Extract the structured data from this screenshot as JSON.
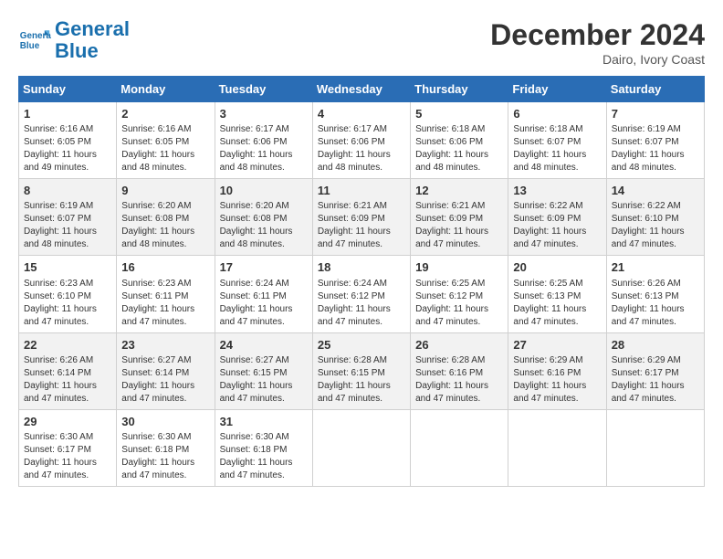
{
  "header": {
    "logo_line1": "General",
    "logo_line2": "Blue",
    "month": "December 2024",
    "location": "Dairo, Ivory Coast"
  },
  "days_of_week": [
    "Sunday",
    "Monday",
    "Tuesday",
    "Wednesday",
    "Thursday",
    "Friday",
    "Saturday"
  ],
  "weeks": [
    [
      {
        "day": "1",
        "info": "Sunrise: 6:16 AM\nSunset: 6:05 PM\nDaylight: 11 hours\nand 49 minutes."
      },
      {
        "day": "2",
        "info": "Sunrise: 6:16 AM\nSunset: 6:05 PM\nDaylight: 11 hours\nand 48 minutes."
      },
      {
        "day": "3",
        "info": "Sunrise: 6:17 AM\nSunset: 6:06 PM\nDaylight: 11 hours\nand 48 minutes."
      },
      {
        "day": "4",
        "info": "Sunrise: 6:17 AM\nSunset: 6:06 PM\nDaylight: 11 hours\nand 48 minutes."
      },
      {
        "day": "5",
        "info": "Sunrise: 6:18 AM\nSunset: 6:06 PM\nDaylight: 11 hours\nand 48 minutes."
      },
      {
        "day": "6",
        "info": "Sunrise: 6:18 AM\nSunset: 6:07 PM\nDaylight: 11 hours\nand 48 minutes."
      },
      {
        "day": "7",
        "info": "Sunrise: 6:19 AM\nSunset: 6:07 PM\nDaylight: 11 hours\nand 48 minutes."
      }
    ],
    [
      {
        "day": "8",
        "info": "Sunrise: 6:19 AM\nSunset: 6:07 PM\nDaylight: 11 hours\nand 48 minutes."
      },
      {
        "day": "9",
        "info": "Sunrise: 6:20 AM\nSunset: 6:08 PM\nDaylight: 11 hours\nand 48 minutes."
      },
      {
        "day": "10",
        "info": "Sunrise: 6:20 AM\nSunset: 6:08 PM\nDaylight: 11 hours\nand 48 minutes."
      },
      {
        "day": "11",
        "info": "Sunrise: 6:21 AM\nSunset: 6:09 PM\nDaylight: 11 hours\nand 47 minutes."
      },
      {
        "day": "12",
        "info": "Sunrise: 6:21 AM\nSunset: 6:09 PM\nDaylight: 11 hours\nand 47 minutes."
      },
      {
        "day": "13",
        "info": "Sunrise: 6:22 AM\nSunset: 6:09 PM\nDaylight: 11 hours\nand 47 minutes."
      },
      {
        "day": "14",
        "info": "Sunrise: 6:22 AM\nSunset: 6:10 PM\nDaylight: 11 hours\nand 47 minutes."
      }
    ],
    [
      {
        "day": "15",
        "info": "Sunrise: 6:23 AM\nSunset: 6:10 PM\nDaylight: 11 hours\nand 47 minutes."
      },
      {
        "day": "16",
        "info": "Sunrise: 6:23 AM\nSunset: 6:11 PM\nDaylight: 11 hours\nand 47 minutes."
      },
      {
        "day": "17",
        "info": "Sunrise: 6:24 AM\nSunset: 6:11 PM\nDaylight: 11 hours\nand 47 minutes."
      },
      {
        "day": "18",
        "info": "Sunrise: 6:24 AM\nSunset: 6:12 PM\nDaylight: 11 hours\nand 47 minutes."
      },
      {
        "day": "19",
        "info": "Sunrise: 6:25 AM\nSunset: 6:12 PM\nDaylight: 11 hours\nand 47 minutes."
      },
      {
        "day": "20",
        "info": "Sunrise: 6:25 AM\nSunset: 6:13 PM\nDaylight: 11 hours\nand 47 minutes."
      },
      {
        "day": "21",
        "info": "Sunrise: 6:26 AM\nSunset: 6:13 PM\nDaylight: 11 hours\nand 47 minutes."
      }
    ],
    [
      {
        "day": "22",
        "info": "Sunrise: 6:26 AM\nSunset: 6:14 PM\nDaylight: 11 hours\nand 47 minutes."
      },
      {
        "day": "23",
        "info": "Sunrise: 6:27 AM\nSunset: 6:14 PM\nDaylight: 11 hours\nand 47 minutes."
      },
      {
        "day": "24",
        "info": "Sunrise: 6:27 AM\nSunset: 6:15 PM\nDaylight: 11 hours\nand 47 minutes."
      },
      {
        "day": "25",
        "info": "Sunrise: 6:28 AM\nSunset: 6:15 PM\nDaylight: 11 hours\nand 47 minutes."
      },
      {
        "day": "26",
        "info": "Sunrise: 6:28 AM\nSunset: 6:16 PM\nDaylight: 11 hours\nand 47 minutes."
      },
      {
        "day": "27",
        "info": "Sunrise: 6:29 AM\nSunset: 6:16 PM\nDaylight: 11 hours\nand 47 minutes."
      },
      {
        "day": "28",
        "info": "Sunrise: 6:29 AM\nSunset: 6:17 PM\nDaylight: 11 hours\nand 47 minutes."
      }
    ],
    [
      {
        "day": "29",
        "info": "Sunrise: 6:30 AM\nSunset: 6:17 PM\nDaylight: 11 hours\nand 47 minutes."
      },
      {
        "day": "30",
        "info": "Sunrise: 6:30 AM\nSunset: 6:18 PM\nDaylight: 11 hours\nand 47 minutes."
      },
      {
        "day": "31",
        "info": "Sunrise: 6:30 AM\nSunset: 6:18 PM\nDaylight: 11 hours\nand 47 minutes."
      },
      {
        "day": "",
        "info": ""
      },
      {
        "day": "",
        "info": ""
      },
      {
        "day": "",
        "info": ""
      },
      {
        "day": "",
        "info": ""
      }
    ]
  ]
}
